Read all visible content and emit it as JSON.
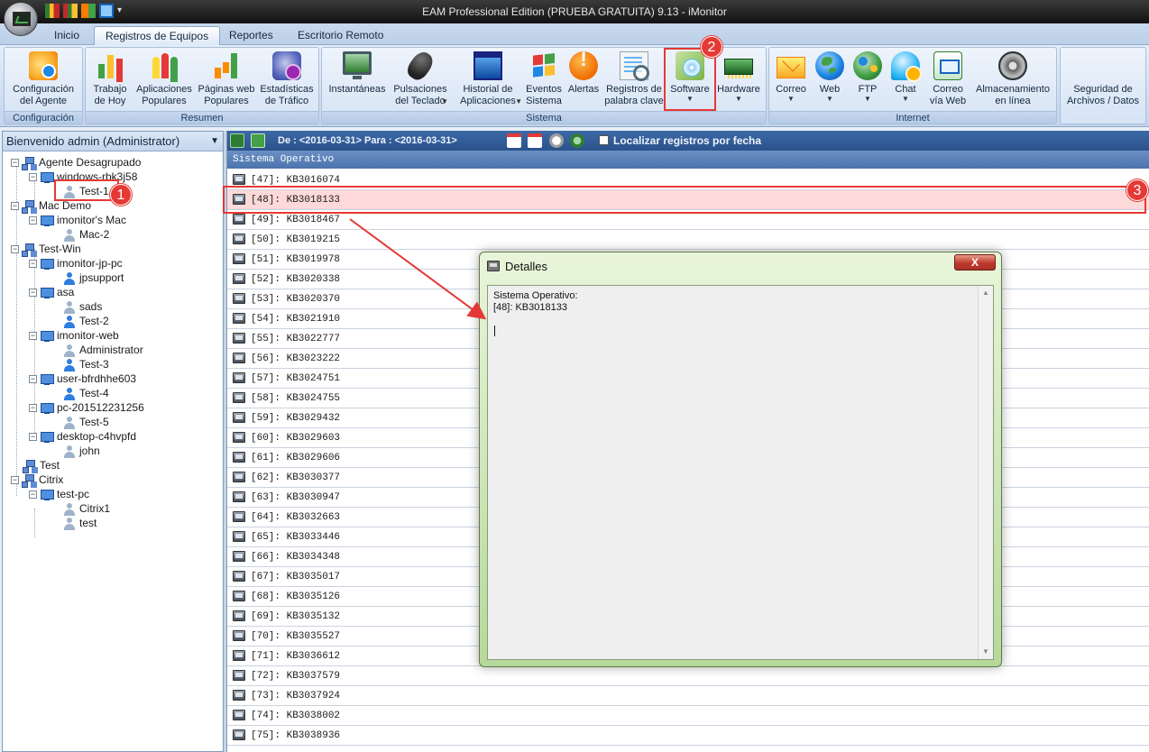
{
  "window": {
    "title": "EAM Professional Edition (PRUEBA GRATUITA) 9.13 - iMonitor"
  },
  "tabs": [
    {
      "label": "Inicio"
    },
    {
      "label": "Registros de Equipos"
    },
    {
      "label": "Reportes"
    },
    {
      "label": "Escritorio Remoto"
    }
  ],
  "ribbon": {
    "groups": {
      "configuracion": "Configuración",
      "resumen": "Resumen",
      "sistema": "Sistema",
      "internet": "Internet"
    },
    "buttons": {
      "config_agente": "Configuración\ndel Agente",
      "trabajo_hoy": "Trabajo\nde Hoy",
      "apps_populares": "Aplicaciones\nPopulares",
      "web_populares": "Páginas web\nPopulares",
      "estadisticas": "Estadísticas\nde Tráfico",
      "instantaneas": "Instantáneas",
      "pulsaciones": "Pulsaciones\ndel Teclado",
      "historial": "Historial de\nAplicaciones",
      "eventos": "Eventos\nSistema",
      "alertas": "Alertas",
      "registros_palabra": "Registros de\npalabra clave",
      "software": "Software",
      "hardware": "Hardware",
      "correo": "Correo",
      "web": "Web",
      "ftp": "FTP",
      "chat": "Chat",
      "correo_web": "Correo\nvía Web",
      "almacenamiento": "Almacenamiento\nen línea",
      "seguridad": "Seguridad de\nArchivos / Datos"
    }
  },
  "sidebar": {
    "header": "Bienvenido admin (Administrator)",
    "tree": [
      {
        "label": "Agente Desagrupado"
      },
      {
        "label": "windows-rbk3j58"
      },
      {
        "label": "Test-1"
      },
      {
        "label": "Mac Demo"
      },
      {
        "label": "imonitor's Mac"
      },
      {
        "label": "Mac-2"
      },
      {
        "label": "Test-Win"
      },
      {
        "label": "imonitor-jp-pc"
      },
      {
        "label": "jpsupport"
      },
      {
        "label": "asa"
      },
      {
        "label": "sads"
      },
      {
        "label": "Test-2"
      },
      {
        "label": "imonitor-web"
      },
      {
        "label": "Administrator"
      },
      {
        "label": "Test-3"
      },
      {
        "label": "user-bfrdhhe603"
      },
      {
        "label": "Test-4"
      },
      {
        "label": "pc-201512231256"
      },
      {
        "label": "Test-5"
      },
      {
        "label": "desktop-c4hvpfd"
      },
      {
        "label": "john"
      },
      {
        "label": "Test"
      },
      {
        "label": "Citrix"
      },
      {
        "label": "test-pc"
      },
      {
        "label": "Citrix1"
      },
      {
        "label": "test"
      }
    ]
  },
  "toolbar": {
    "date_range": "De : <2016-03-31> Para : <2016-03-31>",
    "locate_label": "Localizar registros por fecha"
  },
  "list": {
    "column_header": "Sistema Operativo",
    "rows": [
      "[47]: KB3016074",
      "[48]: KB3018133",
      "[49]: KB3018467",
      "[50]: KB3019215",
      "[51]: KB3019978",
      "[52]: KB3020338",
      "[53]: KB3020370",
      "[54]: KB3021910",
      "[55]: KB3022777",
      "[56]: KB3023222",
      "[57]: KB3024751",
      "[58]: KB3024755",
      "[59]: KB3029432",
      "[60]: KB3029603",
      "[61]: KB3029606",
      "[62]: KB3030377",
      "[63]: KB3030947",
      "[64]: KB3032663",
      "[65]: KB3033446",
      "[66]: KB3034348",
      "[67]: KB3035017",
      "[68]: KB3035126",
      "[69]: KB3035132",
      "[70]: KB3035527",
      "[71]: KB3036612",
      "[72]: KB3037579",
      "[73]: KB3037924",
      "[74]: KB3038002",
      "[75]: KB3038936"
    ]
  },
  "dialog": {
    "title": "Detalles",
    "close_label": "X",
    "content": "Sistema Operativo:\n[48]: KB3018133"
  },
  "annotations": [
    "1",
    "2",
    "3"
  ]
}
